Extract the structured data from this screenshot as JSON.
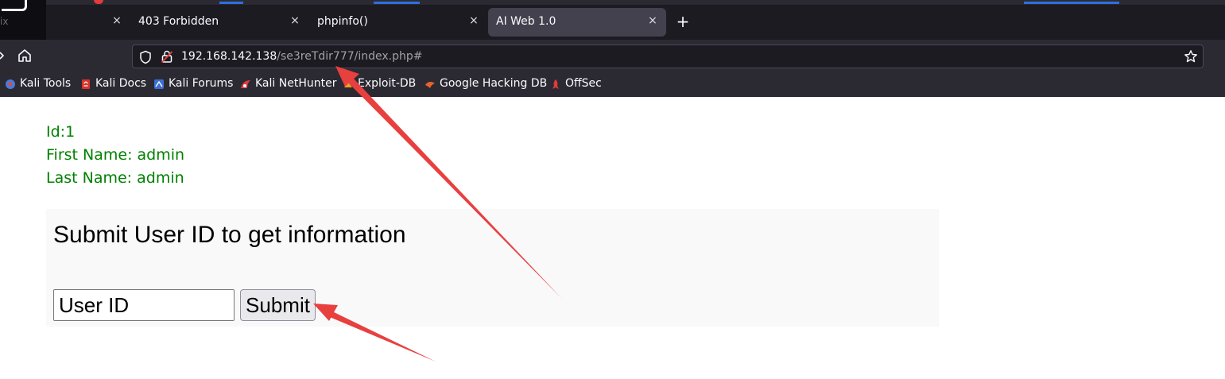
{
  "browser": {
    "tabs": [
      {
        "label": "",
        "active": false
      },
      {
        "label": "403 Forbidden",
        "active": false
      },
      {
        "label": "phpinfo()",
        "active": false
      },
      {
        "label": "AI Web 1.0",
        "active": true
      }
    ],
    "tab_close_glyph": "×",
    "new_tab_glyph": "+",
    "clipped_left_text": "ix",
    "url": {
      "host": "192.168.142.138",
      "path": "/se3reTdir777/index.php#"
    },
    "bookmarks": [
      {
        "label": "Kali Tools",
        "icon": "kali-tools-icon",
        "color": "#4a7bd8"
      },
      {
        "label": "Kali Docs",
        "icon": "kali-docs-icon",
        "color": "#d9332b"
      },
      {
        "label": "Kali Forums",
        "icon": "kali-forums-icon",
        "color": "#3b6fd6"
      },
      {
        "label": "Kali NetHunter",
        "icon": "kali-nethunter-icon",
        "color": "#e0393e"
      },
      {
        "label": "Exploit-DB",
        "icon": "exploit-db-icon",
        "color": "#f0a020"
      },
      {
        "label": "Google Hacking DB",
        "icon": "ghdb-icon",
        "color": "#e8622a"
      },
      {
        "label": "OffSec",
        "icon": "offsec-icon",
        "color": "#e03a3a"
      }
    ]
  },
  "page": {
    "result": {
      "id_line": "Id:1",
      "first_name_line": "First Name: admin",
      "last_name_line": "Last Name: admin"
    },
    "form": {
      "title": "Submit User ID to get information",
      "input_placeholder": "User ID",
      "submit_label": "Submit"
    }
  },
  "colors": {
    "result_text": "#008000",
    "annotation_arrow": "#e8403f",
    "chrome_dark": "#1c1b22",
    "chrome_toolbar": "#2b2a33"
  }
}
